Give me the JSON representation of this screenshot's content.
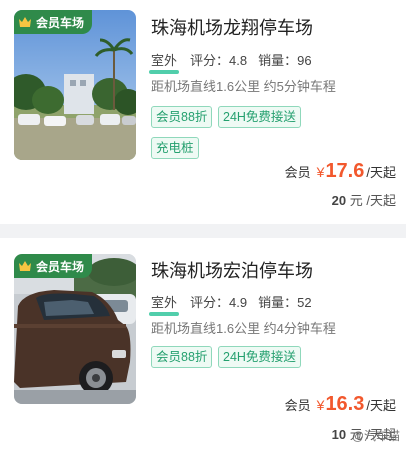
{
  "listings": [
    {
      "badge": "会员车场",
      "title": "珠海机场龙翔停车场",
      "environment": "室外",
      "score_label": "评分：",
      "score": "4.8",
      "sales_label": "销量：",
      "sales": "96",
      "distance": "距机场直线1.6公里 约5分钟车程",
      "tags": [
        "会员88折",
        "24H免费接送",
        "充电桩"
      ],
      "price": {
        "member_label": "会员",
        "currency": "¥",
        "amount": "17.6",
        "unit": "/天起"
      },
      "original": {
        "amount": "20",
        "unit": "元 /天起"
      }
    },
    {
      "badge": "会员车场",
      "title": "珠海机场宏泊停车场",
      "environment": "室外",
      "score_label": "评分：",
      "score": "4.9",
      "sales_label": "销量：",
      "sales": "52",
      "distance": "距机场直线1.6公里 约4分钟车程",
      "tags": [
        "会员88折",
        "24H免费接送"
      ],
      "price": {
        "member_label": "会员",
        "currency": "¥",
        "amount": "16.3",
        "unit": "/天起"
      },
      "original": {
        "amount": "10",
        "unit": "元 /天起"
      }
    }
  ],
  "watermark": "@汽车猫",
  "colors": {
    "accent_green": "#25a06f",
    "price_orange": "#f2582d",
    "badge_green": "#2f8a4a"
  }
}
